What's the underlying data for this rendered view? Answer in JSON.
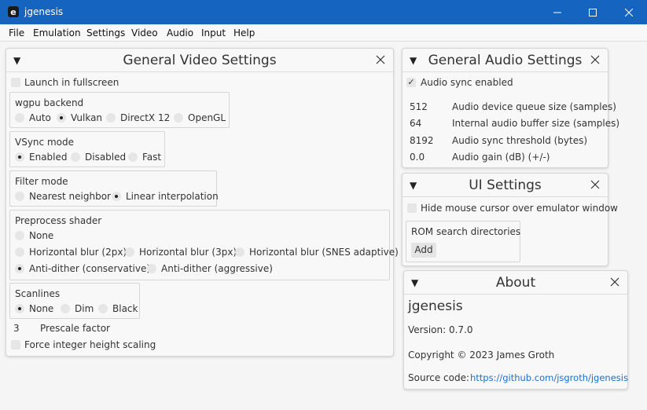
{
  "window": {
    "title": "jgenesis",
    "app_icon_letter": "e"
  },
  "menu": [
    "File",
    "Emulation",
    "Settings",
    "Video",
    "Audio",
    "Input",
    "Help"
  ],
  "video": {
    "title": "General Video Settings",
    "launch_fullscreen": "Launch in fullscreen",
    "wgpu": {
      "label": "wgpu backend",
      "options": [
        "Auto",
        "Vulkan",
        "DirectX 12",
        "OpenGL"
      ],
      "selected": "Vulkan"
    },
    "vsync": {
      "label": "VSync mode",
      "options": [
        "Enabled",
        "Disabled",
        "Fast"
      ],
      "selected": "Enabled"
    },
    "filter": {
      "label": "Filter mode",
      "options": [
        "Nearest neighbor",
        "Linear interpolation"
      ],
      "selected": "Linear interpolation"
    },
    "shader": {
      "label": "Preprocess shader",
      "options": [
        "None",
        "Horizontal blur (2px)",
        "Horizontal blur (3px)",
        "Horizontal blur (SNES adaptive)",
        "Anti-dither (conservative)",
        "Anti-dither (aggressive)"
      ],
      "selected": "Anti-dither (conservative)"
    },
    "scanlines": {
      "label": "Scanlines",
      "options": [
        "None",
        "Dim",
        "Black"
      ],
      "selected": "None"
    },
    "prescale": {
      "value": "3",
      "label": "Prescale factor"
    },
    "force_integer": "Force integer height scaling"
  },
  "audio": {
    "title": "General Audio Settings",
    "sync_label": "Audio sync enabled",
    "sync_check": "✓",
    "rows": [
      {
        "value": "512",
        "label": "Audio device queue size (samples)"
      },
      {
        "value": "64",
        "label": "Internal audio buffer size (samples)"
      },
      {
        "value": "8192",
        "label": "Audio sync threshold (bytes)"
      },
      {
        "value": "0.0",
        "label": "Audio gain (dB) (+/-)"
      }
    ]
  },
  "ui": {
    "title": "UI Settings",
    "hide_cursor": "Hide mouse cursor over emulator window",
    "rom_label": "ROM search directories",
    "add_label": "Add"
  },
  "about": {
    "title": "About",
    "app_name": "jgenesis",
    "version": "Version: 0.7.0",
    "copyright": "Copyright © 2023 James Groth",
    "source_label": "Source code:",
    "source_url": "https://github.com/jsgroth/jgenesis"
  },
  "icons": {
    "collapse": "▼",
    "close": "×"
  },
  "colors": {
    "titlebar": "#1565c0",
    "link": "#1a6fd1"
  }
}
